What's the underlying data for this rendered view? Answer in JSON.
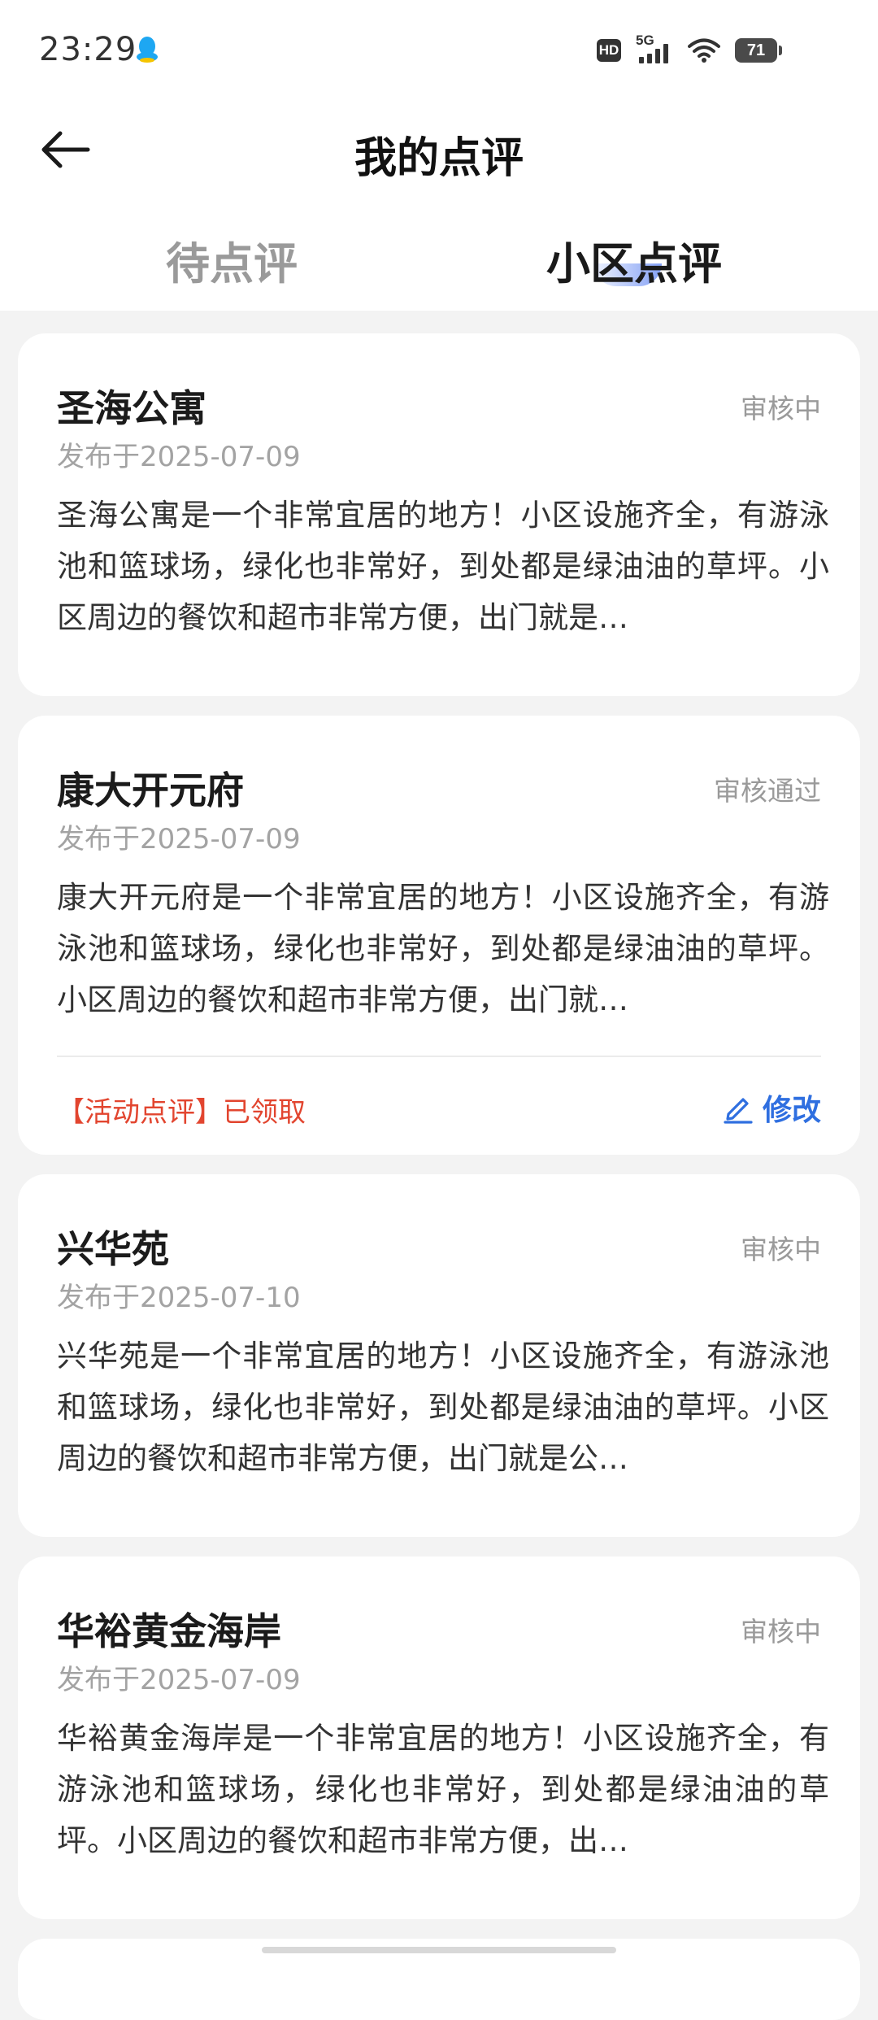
{
  "status_bar": {
    "time": "23:29",
    "network": "5G",
    "hd_label": "HD",
    "battery": "71"
  },
  "header": {
    "title": "我的点评"
  },
  "tabs": [
    {
      "label": "待点评",
      "active": false
    },
    {
      "label": "小区点评",
      "active": true
    }
  ],
  "reviews": [
    {
      "name": "圣海公寓",
      "status": "审核中",
      "date": "发布于2025-07-09",
      "content": "圣海公寓是一个非常宜居的地方！小区设施齐全，有游泳池和篮球场，绿化也非常好，到处都是绿油油的草坪。小区周边的餐饮和超市非常方便，出门就是…"
    },
    {
      "name": "康大开元府",
      "status": "审核通过",
      "date": "发布于2025-07-09",
      "content": "康大开元府是一个非常宜居的地方！小区设施齐全，有游泳池和篮球场，绿化也非常好，到处都是绿油油的草坪。小区周边的餐饮和超市非常方便，出门就…",
      "activity_tag": "【活动点评】已领取",
      "edit_label": "修改"
    },
    {
      "name": "兴华苑",
      "status": "审核中",
      "date": "发布于2025-07-10",
      "content": "兴华苑是一个非常宜居的地方！小区设施齐全，有游泳池和篮球场，绿化也非常好，到处都是绿油油的草坪。小区周边的餐饮和超市非常方便，出门就是公…"
    },
    {
      "name": "华裕黄金海岸",
      "status": "审核中",
      "date": "发布于2025-07-09",
      "content": "华裕黄金海岸是一个非常宜居的地方！小区设施齐全，有游泳池和篮球场，绿化也非常好，到处都是绿油油的草坪。小区周边的餐饮和超市非常方便，出…"
    }
  ],
  "colors": {
    "accent_blue": "#2f6fe0",
    "activity_red": "#e2452f",
    "page_bg": "#f3f3f3"
  }
}
